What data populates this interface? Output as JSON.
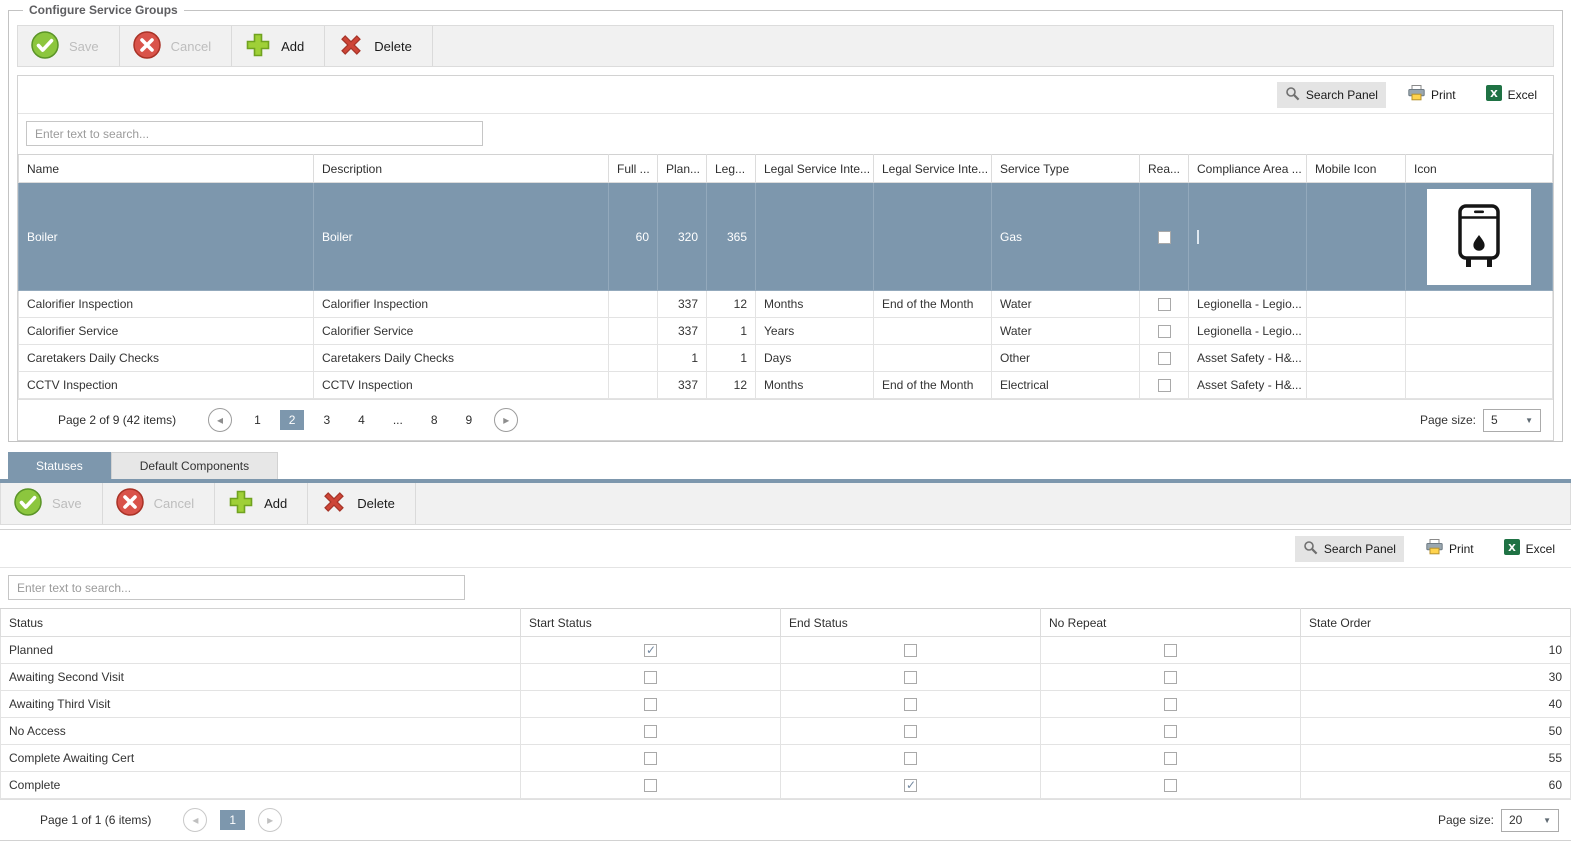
{
  "groupbox": {
    "title": "Configure Service Groups"
  },
  "toolbar": {
    "save": "Save",
    "cancel": "Cancel",
    "add": "Add",
    "delete": "Delete"
  },
  "grid_controls": {
    "search_panel": "Search Panel",
    "print": "Print",
    "excel": "Excel",
    "search_placeholder": "Enter text to search..."
  },
  "service_grid": {
    "columns": [
      "Name",
      "Description",
      "Full ...",
      "Plan...",
      "Leg...",
      "Legal Service Inte...",
      "Legal Service Inte...",
      "Service Type",
      "Rea...",
      "Compliance Area ...",
      "Mobile Icon",
      "Icon"
    ],
    "rows": [
      {
        "name": "Boiler",
        "description": "Boiler",
        "full": "60",
        "plan": "320",
        "leg": "365",
        "interval1": "",
        "interval2": "",
        "service_type": "Gas",
        "reactive": false,
        "compliance": "",
        "mobile_icon": "",
        "icon": "boiler-icon",
        "selected": true
      },
      {
        "name": "Calorifier Inspection",
        "description": "Calorifier Inspection",
        "full": "",
        "plan": "337",
        "leg": "12",
        "interval1": "Months",
        "interval2": "End of the Month",
        "service_type": "Water",
        "reactive": false,
        "compliance": "Legionella - Legio...",
        "mobile_icon": "",
        "icon": ""
      },
      {
        "name": "Calorifier Service",
        "description": "Calorifier Service",
        "full": "",
        "plan": "337",
        "leg": "1",
        "interval1": "Years",
        "interval2": "",
        "service_type": "Water",
        "reactive": false,
        "compliance": "Legionella - Legio...",
        "mobile_icon": "",
        "icon": ""
      },
      {
        "name": "Caretakers Daily Checks",
        "description": "Caretakers Daily Checks",
        "full": "",
        "plan": "1",
        "leg": "1",
        "interval1": "Days",
        "interval2": "",
        "service_type": "Other",
        "reactive": false,
        "compliance": "Asset Safety - H&...",
        "mobile_icon": "",
        "icon": ""
      },
      {
        "name": "CCTV Inspection",
        "description": "CCTV Inspection",
        "full": "",
        "plan": "337",
        "leg": "12",
        "interval1": "Months",
        "interval2": "End of the Month",
        "service_type": "Electrical",
        "reactive": false,
        "compliance": "Asset Safety - H&...",
        "mobile_icon": "",
        "icon": ""
      }
    ],
    "pager": {
      "summary": "Page 2 of 9 (42 items)",
      "pages": [
        "1",
        "2",
        "3",
        "4",
        "...",
        "8",
        "9"
      ],
      "active_page": "2",
      "page_size_label": "Page size:",
      "page_size": "5"
    }
  },
  "tabs": {
    "statuses": "Statuses",
    "default_components": "Default Components"
  },
  "status_grid": {
    "columns": [
      "Status",
      "Start Status",
      "End Status",
      "No Repeat",
      "State Order"
    ],
    "rows": [
      {
        "status": "Planned",
        "start": true,
        "end": false,
        "no_repeat": false,
        "order": "10"
      },
      {
        "status": "Awaiting Second Visit",
        "start": false,
        "end": false,
        "no_repeat": false,
        "order": "30"
      },
      {
        "status": "Awaiting Third Visit",
        "start": false,
        "end": false,
        "no_repeat": false,
        "order": "40"
      },
      {
        "status": "No Access",
        "start": false,
        "end": false,
        "no_repeat": false,
        "order": "50"
      },
      {
        "status": "Complete Awaiting Cert",
        "start": false,
        "end": false,
        "no_repeat": false,
        "order": "55"
      },
      {
        "status": "Complete",
        "start": false,
        "end": true,
        "no_repeat": false,
        "order": "60"
      }
    ],
    "pager": {
      "summary": "Page 1 of 1 (6 items)",
      "pages": [
        "1"
      ],
      "active_page": "1",
      "page_size_label": "Page size:",
      "page_size": "20"
    }
  },
  "colors": {
    "accent": "#7d97ad",
    "save_green": "#8cc63e",
    "cancel_red": "#d9534a",
    "excel_green": "#1f7244"
  }
}
